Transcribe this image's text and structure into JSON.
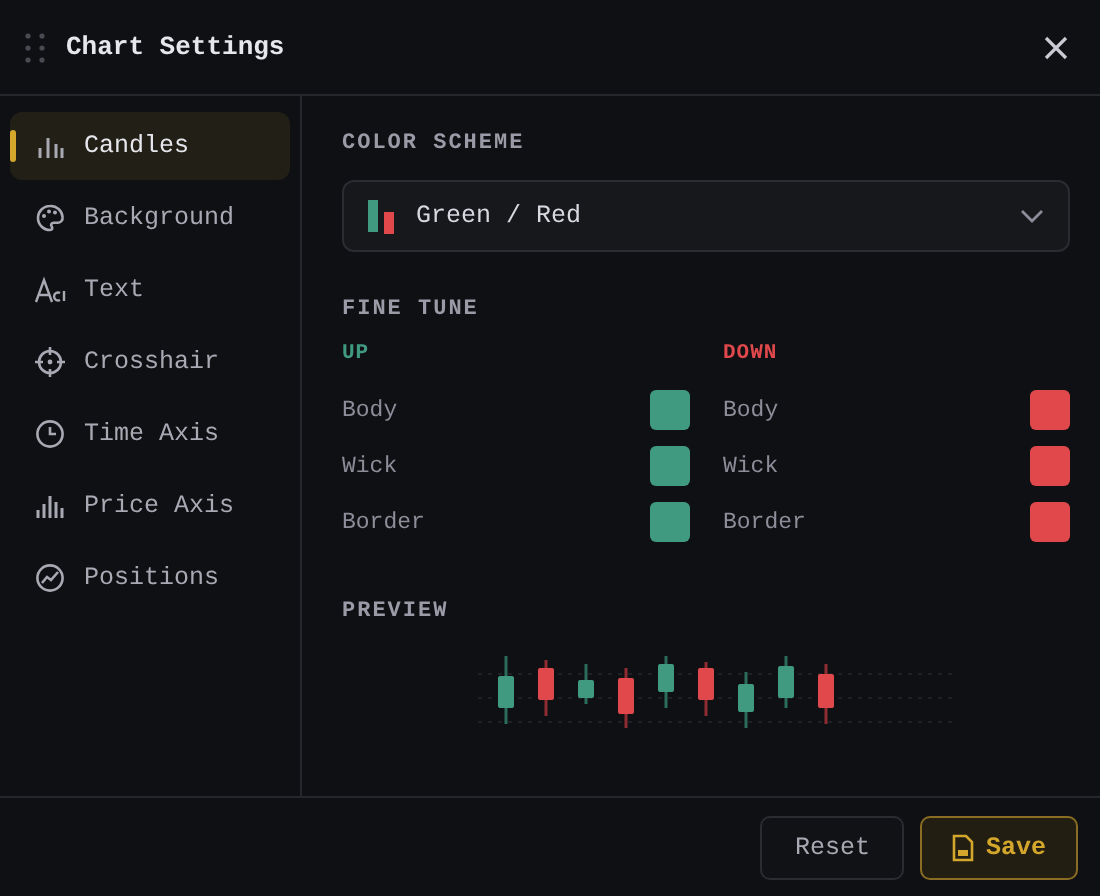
{
  "window": {
    "title": "Chart Settings"
  },
  "sidebar": {
    "items": [
      {
        "label": "Candles",
        "selected": true
      },
      {
        "label": "Background",
        "selected": false
      },
      {
        "label": "Text",
        "selected": false
      },
      {
        "label": "Crosshair",
        "selected": false
      },
      {
        "label": "Time Axis",
        "selected": false
      },
      {
        "label": "Price Axis",
        "selected": false
      },
      {
        "label": "Positions",
        "selected": false
      }
    ]
  },
  "color_scheme": {
    "heading": "COLOR SCHEME",
    "value": "Green / Red"
  },
  "fine_tune": {
    "heading": "FINE TUNE",
    "columns": [
      {
        "heading": "UP",
        "color": "#3f9a80",
        "rows": [
          {
            "label": "Body",
            "color": "#3f9a80"
          },
          {
            "label": "Wick",
            "color": "#3f9a80"
          },
          {
            "label": "Border",
            "color": "#3f9a80"
          }
        ]
      },
      {
        "heading": "DOWN",
        "color": "#e0484c",
        "rows": [
          {
            "label": "Body",
            "color": "#e0484c"
          },
          {
            "label": "Wick",
            "color": "#e0484c"
          },
          {
            "label": "Border",
            "color": "#e0484c"
          }
        ]
      }
    ]
  },
  "preview": {
    "heading": "PREVIEW"
  },
  "buttons": [
    {
      "label": "Reset",
      "kind": "secondary"
    },
    {
      "label": "Save",
      "kind": "primary"
    }
  ]
}
